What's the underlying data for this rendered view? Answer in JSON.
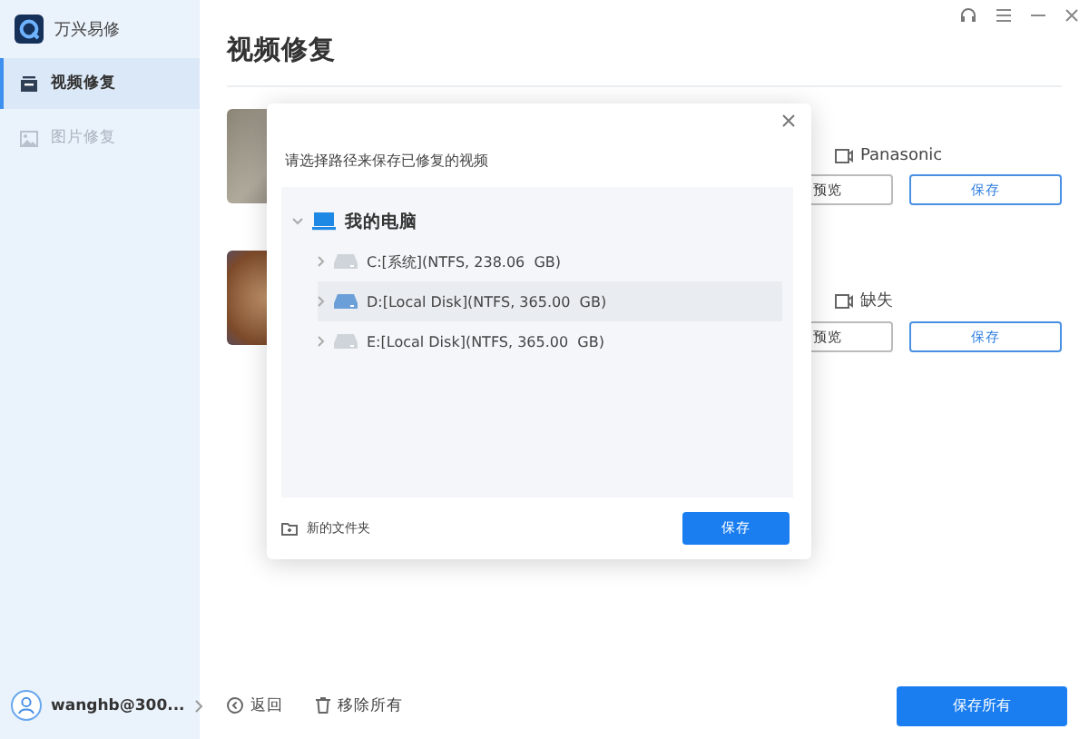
{
  "app": {
    "title": "万兴易修"
  },
  "window_controls": [
    {
      "kind": "support"
    },
    {
      "kind": "menu"
    },
    {
      "kind": "minimize"
    },
    {
      "kind": "close"
    }
  ],
  "sidebar": {
    "items": [
      {
        "label": "视频修复",
        "kind": "video",
        "selected": true
      },
      {
        "label": "图片修复",
        "kind": "image",
        "selected": false
      }
    ],
    "user": {
      "name": "wanghb@300..."
    }
  },
  "page": {
    "title": "视频修复"
  },
  "videos": [
    {
      "camera": "Panasonic",
      "preview": "预览",
      "save": "保存"
    },
    {
      "camera": "缺失",
      "preview": "预览",
      "save": "保存"
    }
  ],
  "dialog": {
    "prompt": "请选择路径来保存已修复的视频",
    "tree": [
      {
        "label": "我的电脑",
        "kind": "computer",
        "expanded": true,
        "children": [
          {
            "label": "C:[系统](NTFS, 238.06  GB)",
            "kind": "drive",
            "expanded": false,
            "selected": false
          },
          {
            "label": "D:[Local Disk](NTFS, 365.00  GB)",
            "kind": "drive",
            "expanded": false,
            "selected": true
          },
          {
            "label": "E:[Local Disk](NTFS, 365.00  GB)",
            "kind": "drive",
            "expanded": false,
            "selected": false
          }
        ]
      }
    ],
    "new_folder": "新的文件夹",
    "save": "保存"
  },
  "footer": {
    "back": "返回",
    "remove_all": "移除所有",
    "save_all": "保存所有"
  }
}
